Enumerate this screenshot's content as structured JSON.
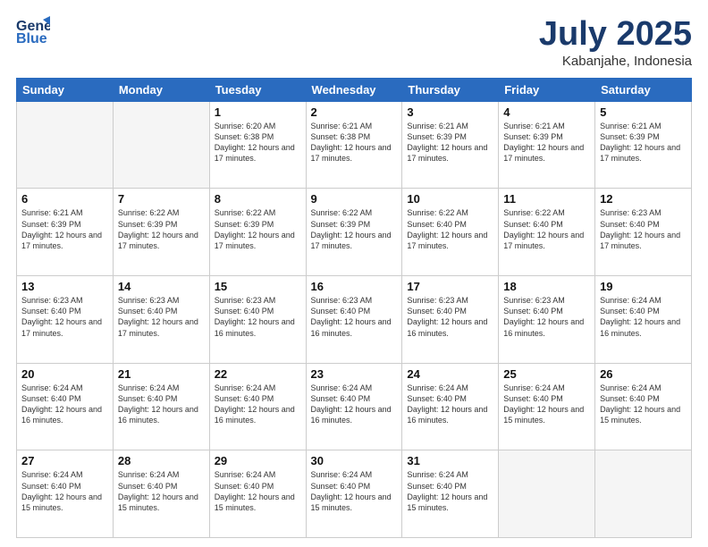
{
  "header": {
    "logo_line1": "General",
    "logo_line2": "Blue",
    "month": "July 2025",
    "location": "Kabanjahe, Indonesia"
  },
  "weekdays": [
    "Sunday",
    "Monday",
    "Tuesday",
    "Wednesday",
    "Thursday",
    "Friday",
    "Saturday"
  ],
  "weeks": [
    [
      {
        "day": "",
        "info": ""
      },
      {
        "day": "",
        "info": ""
      },
      {
        "day": "1",
        "info": "Sunrise: 6:20 AM\nSunset: 6:38 PM\nDaylight: 12 hours and 17 minutes."
      },
      {
        "day": "2",
        "info": "Sunrise: 6:21 AM\nSunset: 6:38 PM\nDaylight: 12 hours and 17 minutes."
      },
      {
        "day": "3",
        "info": "Sunrise: 6:21 AM\nSunset: 6:39 PM\nDaylight: 12 hours and 17 minutes."
      },
      {
        "day": "4",
        "info": "Sunrise: 6:21 AM\nSunset: 6:39 PM\nDaylight: 12 hours and 17 minutes."
      },
      {
        "day": "5",
        "info": "Sunrise: 6:21 AM\nSunset: 6:39 PM\nDaylight: 12 hours and 17 minutes."
      }
    ],
    [
      {
        "day": "6",
        "info": "Sunrise: 6:21 AM\nSunset: 6:39 PM\nDaylight: 12 hours and 17 minutes."
      },
      {
        "day": "7",
        "info": "Sunrise: 6:22 AM\nSunset: 6:39 PM\nDaylight: 12 hours and 17 minutes."
      },
      {
        "day": "8",
        "info": "Sunrise: 6:22 AM\nSunset: 6:39 PM\nDaylight: 12 hours and 17 minutes."
      },
      {
        "day": "9",
        "info": "Sunrise: 6:22 AM\nSunset: 6:39 PM\nDaylight: 12 hours and 17 minutes."
      },
      {
        "day": "10",
        "info": "Sunrise: 6:22 AM\nSunset: 6:40 PM\nDaylight: 12 hours and 17 minutes."
      },
      {
        "day": "11",
        "info": "Sunrise: 6:22 AM\nSunset: 6:40 PM\nDaylight: 12 hours and 17 minutes."
      },
      {
        "day": "12",
        "info": "Sunrise: 6:23 AM\nSunset: 6:40 PM\nDaylight: 12 hours and 17 minutes."
      }
    ],
    [
      {
        "day": "13",
        "info": "Sunrise: 6:23 AM\nSunset: 6:40 PM\nDaylight: 12 hours and 17 minutes."
      },
      {
        "day": "14",
        "info": "Sunrise: 6:23 AM\nSunset: 6:40 PM\nDaylight: 12 hours and 17 minutes."
      },
      {
        "day": "15",
        "info": "Sunrise: 6:23 AM\nSunset: 6:40 PM\nDaylight: 12 hours and 16 minutes."
      },
      {
        "day": "16",
        "info": "Sunrise: 6:23 AM\nSunset: 6:40 PM\nDaylight: 12 hours and 16 minutes."
      },
      {
        "day": "17",
        "info": "Sunrise: 6:23 AM\nSunset: 6:40 PM\nDaylight: 12 hours and 16 minutes."
      },
      {
        "day": "18",
        "info": "Sunrise: 6:23 AM\nSunset: 6:40 PM\nDaylight: 12 hours and 16 minutes."
      },
      {
        "day": "19",
        "info": "Sunrise: 6:24 AM\nSunset: 6:40 PM\nDaylight: 12 hours and 16 minutes."
      }
    ],
    [
      {
        "day": "20",
        "info": "Sunrise: 6:24 AM\nSunset: 6:40 PM\nDaylight: 12 hours and 16 minutes."
      },
      {
        "day": "21",
        "info": "Sunrise: 6:24 AM\nSunset: 6:40 PM\nDaylight: 12 hours and 16 minutes."
      },
      {
        "day": "22",
        "info": "Sunrise: 6:24 AM\nSunset: 6:40 PM\nDaylight: 12 hours and 16 minutes."
      },
      {
        "day": "23",
        "info": "Sunrise: 6:24 AM\nSunset: 6:40 PM\nDaylight: 12 hours and 16 minutes."
      },
      {
        "day": "24",
        "info": "Sunrise: 6:24 AM\nSunset: 6:40 PM\nDaylight: 12 hours and 16 minutes."
      },
      {
        "day": "25",
        "info": "Sunrise: 6:24 AM\nSunset: 6:40 PM\nDaylight: 12 hours and 15 minutes."
      },
      {
        "day": "26",
        "info": "Sunrise: 6:24 AM\nSunset: 6:40 PM\nDaylight: 12 hours and 15 minutes."
      }
    ],
    [
      {
        "day": "27",
        "info": "Sunrise: 6:24 AM\nSunset: 6:40 PM\nDaylight: 12 hours and 15 minutes."
      },
      {
        "day": "28",
        "info": "Sunrise: 6:24 AM\nSunset: 6:40 PM\nDaylight: 12 hours and 15 minutes."
      },
      {
        "day": "29",
        "info": "Sunrise: 6:24 AM\nSunset: 6:40 PM\nDaylight: 12 hours and 15 minutes."
      },
      {
        "day": "30",
        "info": "Sunrise: 6:24 AM\nSunset: 6:40 PM\nDaylight: 12 hours and 15 minutes."
      },
      {
        "day": "31",
        "info": "Sunrise: 6:24 AM\nSunset: 6:40 PM\nDaylight: 12 hours and 15 minutes."
      },
      {
        "day": "",
        "info": ""
      },
      {
        "day": "",
        "info": ""
      }
    ]
  ]
}
